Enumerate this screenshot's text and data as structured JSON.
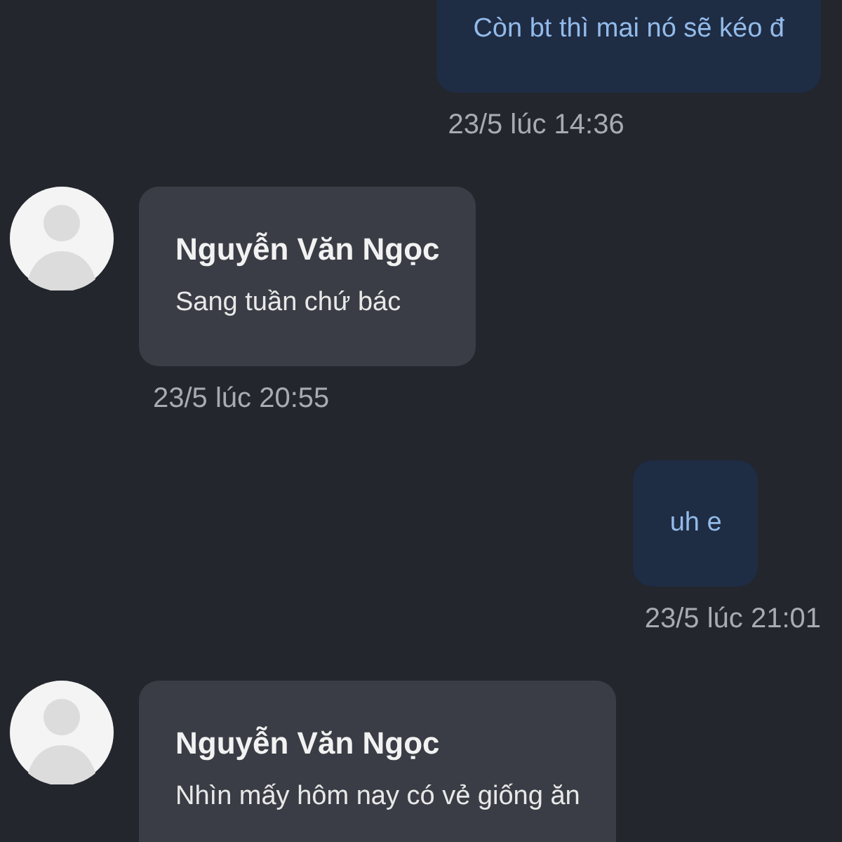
{
  "messages": [
    {
      "kind": "outgoing",
      "text": "Còn bt thì mai nó sẽ kéo đ",
      "time": "23/5 lúc 14:36"
    },
    {
      "kind": "incoming",
      "sender": "Nguyễn Văn Ngọc",
      "text": "Sang tuần chứ bác",
      "time": "23/5 lúc 20:55"
    },
    {
      "kind": "outgoing",
      "text": "uh e",
      "time": "23/5 lúc 21:01"
    },
    {
      "kind": "incoming",
      "sender": "Nguyễn Văn Ngọc",
      "text": "Nhìn mấy hôm nay có vẻ giống ăn"
    }
  ]
}
